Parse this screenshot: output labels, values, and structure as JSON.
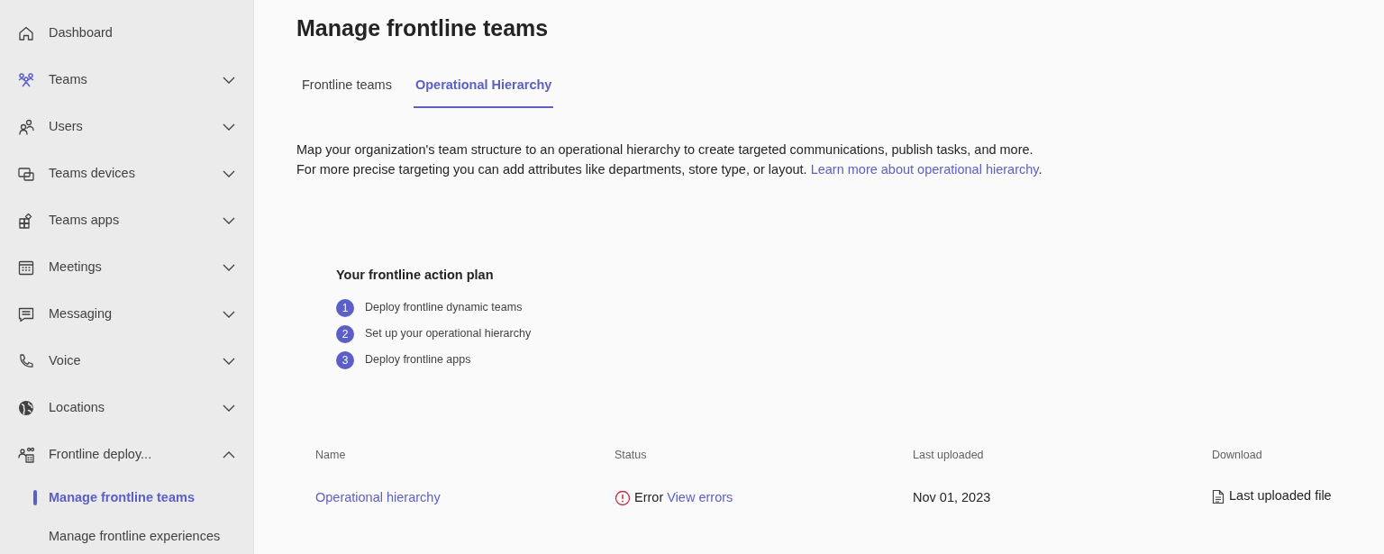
{
  "sidebar": {
    "items": [
      {
        "label": "Dashboard",
        "kind": "link"
      },
      {
        "label": "Teams",
        "kind": "group",
        "expanded": false
      },
      {
        "label": "Users",
        "kind": "group",
        "expanded": false
      },
      {
        "label": "Teams devices",
        "kind": "group",
        "expanded": false
      },
      {
        "label": "Teams apps",
        "kind": "group",
        "expanded": false
      },
      {
        "label": "Meetings",
        "kind": "group",
        "expanded": false
      },
      {
        "label": "Messaging",
        "kind": "group",
        "expanded": false
      },
      {
        "label": "Voice",
        "kind": "group",
        "expanded": false
      },
      {
        "label": "Locations",
        "kind": "group",
        "expanded": false
      },
      {
        "label": "Frontline deploy...",
        "kind": "group",
        "expanded": true,
        "children": [
          {
            "label": "Manage frontline teams",
            "selected": true
          },
          {
            "label": "Manage frontline experiences",
            "selected": false
          }
        ]
      }
    ]
  },
  "page": {
    "title": "Manage frontline teams",
    "tabs": [
      {
        "label": "Frontline teams",
        "selected": false
      },
      {
        "label": "Operational Hierarchy",
        "selected": true
      }
    ],
    "description": {
      "text": "Map your organization's team structure to an operational hierarchy to create targeted communications, publish tasks, and more. For more precise targeting you can add attributes like departments, store type, or layout.",
      "link": "Learn more about operational hierarchy",
      "end": "."
    },
    "action_plan": {
      "title": "Your frontline action plan",
      "steps": [
        {
          "number": "1",
          "label": "Deploy frontline dynamic teams"
        },
        {
          "number": "2",
          "label": "Set up your operational hierarchy"
        },
        {
          "number": "3",
          "label": "Deploy frontline apps"
        }
      ]
    },
    "table": {
      "columns": [
        "Name",
        "Status",
        "Last uploaded",
        "Download"
      ],
      "rows": [
        {
          "name": "Operational hierarchy",
          "status": "Error",
          "kind": "error",
          "status_link": "View errors",
          "last_uploaded": "Nov 01, 2023",
          "download": "Last uploaded file"
        }
      ]
    }
  }
}
